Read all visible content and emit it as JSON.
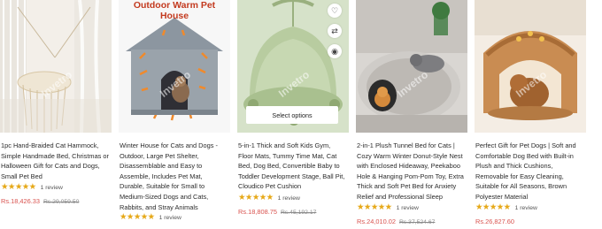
{
  "products": [
    {
      "title": "1pc Hand-Braided Cat Hammock, Simple Handmade Bed, Christmas or Halloween Gift for Cats and Dogs, Small Pet Bed",
      "rating_stars": "★★★★★",
      "reviews": "1 review",
      "sale_price": "Rs.18,426.33",
      "original_price": "Rs.29,059.50",
      "image_label": "cat-hammock-image"
    },
    {
      "title": "Winter House for Cats and Dogs - Outdoor, Large Pet Shelter, Disassemblable and Easy to Assemble, Includes Pet Mat, Durable, Suitable for Small to Medium-Sized Dogs and Cats, Rabbits, and Stray Animals",
      "rating_stars": "★★★★★",
      "reviews": "1 review",
      "sale_price": "",
      "original_price": "",
      "image_banner": "Outdoor Warm Pet House",
      "image_label": "winter-pet-house-image"
    },
    {
      "title": "5-in-1 Thick and Soft Kids Gym, Floor Mats, Tummy Time Mat, Cat Bed, Dog Bed, Convertible Baby to Toddler Development Stage, Ball Pit, Cloudico Pet Cushion",
      "rating_stars": "★★★★★",
      "reviews": "1 review",
      "sale_price": "Rs.18,808.75",
      "original_price": "Rs.45,192.17",
      "select_label": "Select options",
      "image_label": "kids-gym-pet-bed-image"
    },
    {
      "title": "2-in-1 Plush Tunnel Bed for Cats | Cozy Warm Winter Donut-Style Nest with Enclosed Hideaway, Peekaboo Hole & Hanging Pom-Pom Toy, Extra Thick and Soft Pet Bed for Anxiety Relief and Professional Sleep",
      "rating_stars": "★★★★★",
      "reviews": "1 review",
      "sale_price": "Rs.24,010.02",
      "original_price": "Rs.37,524.67",
      "image_label": "plush-tunnel-bed-image"
    },
    {
      "title": "Perfect Gift for Pet Dogs | Soft and Comfortable Dog Bed with Built-in Plush and Thick Cushions, Removable for Easy Cleaning, Suitable for All Seasons, Brown Polyester Material",
      "rating_stars": "★★★★★",
      "reviews": "1 review",
      "sale_price": "Rs.26,827.60",
      "original_price": "",
      "image_label": "dog-house-bed-image"
    }
  ],
  "watermark": "Invetro",
  "colors": {
    "star": "#e6a817",
    "sale": "#d9534f",
    "strike": "#8a8a8a"
  },
  "icons": [
    "heart-icon",
    "shuffle-icon",
    "eye-icon"
  ]
}
